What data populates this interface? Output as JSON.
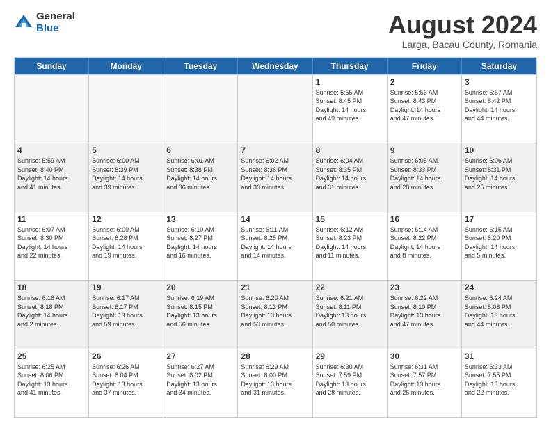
{
  "logo": {
    "general": "General",
    "blue": "Blue"
  },
  "title": "August 2024",
  "subtitle": "Larga, Bacau County, Romania",
  "header_days": [
    "Sunday",
    "Monday",
    "Tuesday",
    "Wednesday",
    "Thursday",
    "Friday",
    "Saturday"
  ],
  "weeks": [
    [
      {
        "day": "",
        "info": ""
      },
      {
        "day": "",
        "info": ""
      },
      {
        "day": "",
        "info": ""
      },
      {
        "day": "",
        "info": ""
      },
      {
        "day": "1",
        "info": "Sunrise: 5:55 AM\nSunset: 8:45 PM\nDaylight: 14 hours\nand 49 minutes."
      },
      {
        "day": "2",
        "info": "Sunrise: 5:56 AM\nSunset: 8:43 PM\nDaylight: 14 hours\nand 47 minutes."
      },
      {
        "day": "3",
        "info": "Sunrise: 5:57 AM\nSunset: 8:42 PM\nDaylight: 14 hours\nand 44 minutes."
      }
    ],
    [
      {
        "day": "4",
        "info": "Sunrise: 5:59 AM\nSunset: 8:40 PM\nDaylight: 14 hours\nand 41 minutes."
      },
      {
        "day": "5",
        "info": "Sunrise: 6:00 AM\nSunset: 8:39 PM\nDaylight: 14 hours\nand 39 minutes."
      },
      {
        "day": "6",
        "info": "Sunrise: 6:01 AM\nSunset: 8:38 PM\nDaylight: 14 hours\nand 36 minutes."
      },
      {
        "day": "7",
        "info": "Sunrise: 6:02 AM\nSunset: 8:36 PM\nDaylight: 14 hours\nand 33 minutes."
      },
      {
        "day": "8",
        "info": "Sunrise: 6:04 AM\nSunset: 8:35 PM\nDaylight: 14 hours\nand 31 minutes."
      },
      {
        "day": "9",
        "info": "Sunrise: 6:05 AM\nSunset: 8:33 PM\nDaylight: 14 hours\nand 28 minutes."
      },
      {
        "day": "10",
        "info": "Sunrise: 6:06 AM\nSunset: 8:31 PM\nDaylight: 14 hours\nand 25 minutes."
      }
    ],
    [
      {
        "day": "11",
        "info": "Sunrise: 6:07 AM\nSunset: 8:30 PM\nDaylight: 14 hours\nand 22 minutes."
      },
      {
        "day": "12",
        "info": "Sunrise: 6:09 AM\nSunset: 8:28 PM\nDaylight: 14 hours\nand 19 minutes."
      },
      {
        "day": "13",
        "info": "Sunrise: 6:10 AM\nSunset: 8:27 PM\nDaylight: 14 hours\nand 16 minutes."
      },
      {
        "day": "14",
        "info": "Sunrise: 6:11 AM\nSunset: 8:25 PM\nDaylight: 14 hours\nand 14 minutes."
      },
      {
        "day": "15",
        "info": "Sunrise: 6:12 AM\nSunset: 8:23 PM\nDaylight: 14 hours\nand 11 minutes."
      },
      {
        "day": "16",
        "info": "Sunrise: 6:14 AM\nSunset: 8:22 PM\nDaylight: 14 hours\nand 8 minutes."
      },
      {
        "day": "17",
        "info": "Sunrise: 6:15 AM\nSunset: 8:20 PM\nDaylight: 14 hours\nand 5 minutes."
      }
    ],
    [
      {
        "day": "18",
        "info": "Sunrise: 6:16 AM\nSunset: 8:18 PM\nDaylight: 14 hours\nand 2 minutes."
      },
      {
        "day": "19",
        "info": "Sunrise: 6:17 AM\nSunset: 8:17 PM\nDaylight: 13 hours\nand 59 minutes."
      },
      {
        "day": "20",
        "info": "Sunrise: 6:19 AM\nSunset: 8:15 PM\nDaylight: 13 hours\nand 56 minutes."
      },
      {
        "day": "21",
        "info": "Sunrise: 6:20 AM\nSunset: 8:13 PM\nDaylight: 13 hours\nand 53 minutes."
      },
      {
        "day": "22",
        "info": "Sunrise: 6:21 AM\nSunset: 8:11 PM\nDaylight: 13 hours\nand 50 minutes."
      },
      {
        "day": "23",
        "info": "Sunrise: 6:22 AM\nSunset: 8:10 PM\nDaylight: 13 hours\nand 47 minutes."
      },
      {
        "day": "24",
        "info": "Sunrise: 6:24 AM\nSunset: 8:08 PM\nDaylight: 13 hours\nand 44 minutes."
      }
    ],
    [
      {
        "day": "25",
        "info": "Sunrise: 6:25 AM\nSunset: 8:06 PM\nDaylight: 13 hours\nand 41 minutes."
      },
      {
        "day": "26",
        "info": "Sunrise: 6:26 AM\nSunset: 8:04 PM\nDaylight: 13 hours\nand 37 minutes."
      },
      {
        "day": "27",
        "info": "Sunrise: 6:27 AM\nSunset: 8:02 PM\nDaylight: 13 hours\nand 34 minutes."
      },
      {
        "day": "28",
        "info": "Sunrise: 6:29 AM\nSunset: 8:00 PM\nDaylight: 13 hours\nand 31 minutes."
      },
      {
        "day": "29",
        "info": "Sunrise: 6:30 AM\nSunset: 7:59 PM\nDaylight: 13 hours\nand 28 minutes."
      },
      {
        "day": "30",
        "info": "Sunrise: 6:31 AM\nSunset: 7:57 PM\nDaylight: 13 hours\nand 25 minutes."
      },
      {
        "day": "31",
        "info": "Sunrise: 6:33 AM\nSunset: 7:55 PM\nDaylight: 13 hours\nand 22 minutes."
      }
    ]
  ]
}
